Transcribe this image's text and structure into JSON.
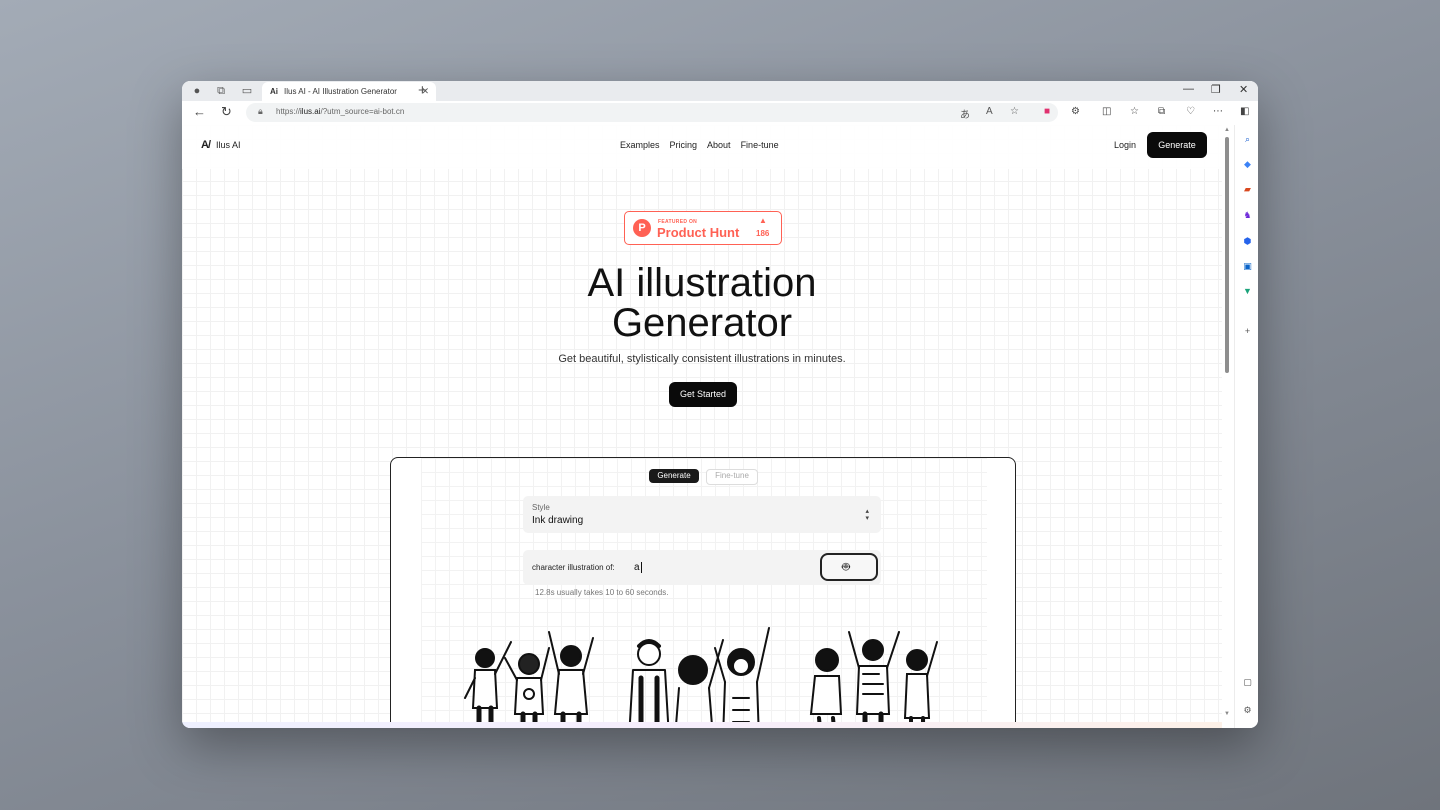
{
  "browser": {
    "tab_title": "Ilus AI - AI Illustration Generator",
    "tab_favicon": "Ai",
    "url_prefix": "https://",
    "url_host": "ilus.ai",
    "url_path": "/?utm_source=ai-bot.cn"
  },
  "site": {
    "logo_mark": "A/",
    "logo_text": "Ilus AI",
    "nav": [
      "Examples",
      "Pricing",
      "About",
      "Fine-tune"
    ],
    "login_label": "Login",
    "generate_label": "Generate"
  },
  "badge": {
    "featured": "FEATURED ON",
    "name": "Product Hunt",
    "count": "186",
    "logo": "P",
    "color": "#ff6154"
  },
  "hero": {
    "title_line1": "AI illustration",
    "title_line2": "Generator",
    "subtitle": "Get beautiful, stylistically consistent illustrations in minutes.",
    "cta_label": "Get Started"
  },
  "demo": {
    "tabs": [
      "Generate",
      "Fine-tune"
    ],
    "style_label": "Style",
    "style_value": "Ink drawing",
    "prompt_label": "character illustration of:",
    "prompt_value": "a",
    "timing": "12.8s usually takes 10 to 60 seconds."
  }
}
